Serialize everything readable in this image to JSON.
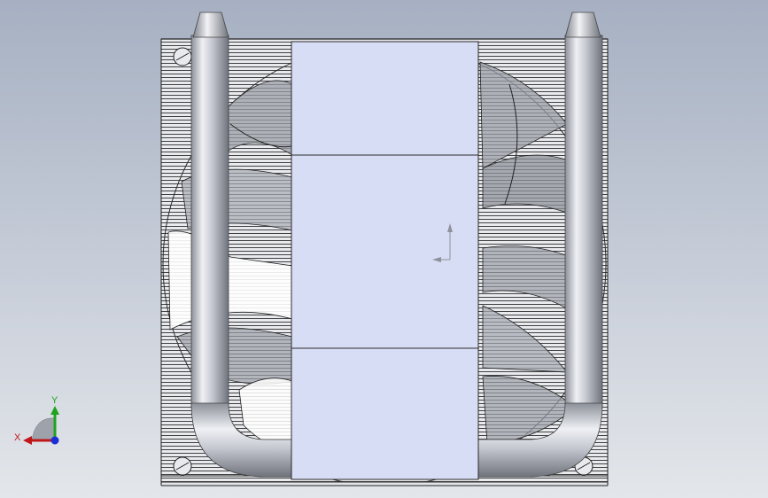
{
  "viewport": {
    "background_top": "#a6b0c2",
    "background_bottom": "#e3e6ea"
  },
  "model": {
    "description_icon": "heatsink-with-heatpipes-and-fan",
    "fin_color": "#e6e8ee",
    "fin_line_color": "#3a3a3a",
    "pipe_color": "#c9ccd3",
    "block_color": "#d8ddf6",
    "blade_color": "#9a9ea6"
  },
  "triad": {
    "x_label": "X",
    "y_label": "Y",
    "x_color": "#c0161a",
    "y_color": "#1fa31f",
    "z_color": "#1a2fd6"
  }
}
